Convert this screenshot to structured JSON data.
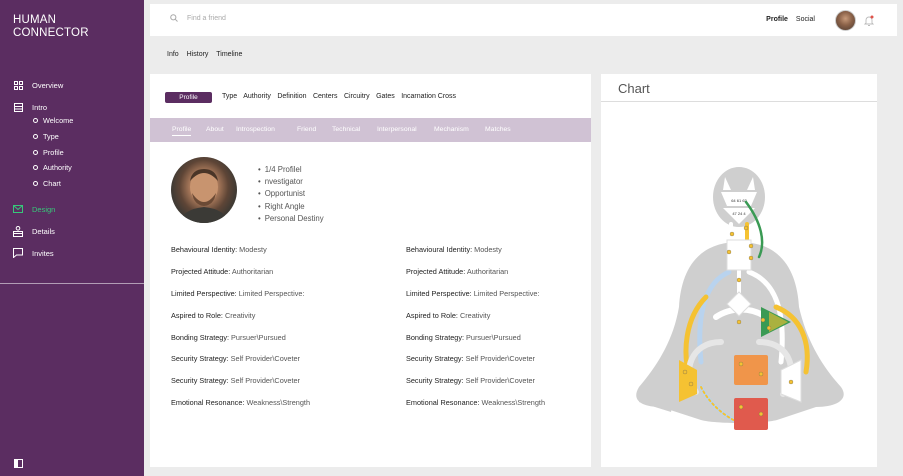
{
  "sidebar": {
    "logo_line1": "HUMAN",
    "logo_line2": "CONNECTOR",
    "items": [
      {
        "label": "Overview",
        "icon": "grid-icon"
      },
      {
        "label": "Intro",
        "icon": "layers-icon"
      },
      {
        "label": "Design",
        "icon": "mail-icon",
        "color": "#37c87a"
      },
      {
        "label": "Details",
        "icon": "person-desk-icon"
      },
      {
        "label": "Invites",
        "icon": "chat-icon"
      }
    ],
    "sub_items": [
      "Welcome",
      "Type",
      "Profile",
      "Authority",
      "Chart"
    ]
  },
  "topbar": {
    "search_placeholder": "Find a friend",
    "profile_link": "Profile",
    "social_link": "Social"
  },
  "subnav": [
    "Info",
    "History",
    "Timeline"
  ],
  "profile_tabs": {
    "pill": "Profile",
    "items": [
      "Type",
      "Authority",
      "Definition",
      "Centers",
      "Circuitry",
      "Gates",
      "Incarnation Cross"
    ]
  },
  "inner_tabs": [
    "Profile",
    "About",
    "Introspection",
    "Friend",
    "Technical",
    "Interpersonal",
    "Mechanism",
    "Matches"
  ],
  "traits": [
    "1/4 Profilel",
    "nvestigator",
    "Opportunist",
    "Right Angle",
    "Personal Destiny"
  ],
  "attributes_left": [
    {
      "label": "Behavioural Identity:",
      "value": "Modesty"
    },
    {
      "label": "Projected Attitude:",
      "value": "Authoritarian"
    },
    {
      "label": "Limited Perspective:",
      "value": "Limited Perspective:"
    },
    {
      "label": "Aspired to Role:",
      "value": "Creativity"
    },
    {
      "label": "Bonding Strategy:",
      "value": "Pursuer\\Pursued"
    },
    {
      "label": "Security Strategy:",
      "value": "Self Provider\\Coveter"
    },
    {
      "label": "Security Strategy:",
      "value": "Self Provider\\Coveter"
    },
    {
      "label": "Emotional Resonance:",
      "value": "Weakness\\Strength"
    }
  ],
  "attributes_right": [
    {
      "label": "Behavioural Identity:",
      "value": "Modesty"
    },
    {
      "label": "Projected Attitude:",
      "value": "Authoritarian"
    },
    {
      "label": "Limited Perspective:",
      "value": "Limited Perspective:"
    },
    {
      "label": "Aspired to Role:",
      "value": "Creativity"
    },
    {
      "label": "Bonding Strategy:",
      "value": "Pursuer\\Pursued"
    },
    {
      "label": "Security Strategy:",
      "value": "Self Provider\\Coveter"
    },
    {
      "label": "Security Strategy:",
      "value": "Self Provider\\Coveter"
    },
    {
      "label": "Emotional Resonance:",
      "value": "Weakness\\Strength"
    }
  ],
  "chart_panel": {
    "title": "Chart",
    "head_gates": "64 61 63",
    "ajna_gates": "47 24 4"
  },
  "colors": {
    "brand": "#5b2d61",
    "tab_bar": "#d0c2d4",
    "design_active": "#37c87a",
    "center_yellow": "#f5c232",
    "center_orange": "#f0954a",
    "center_red": "#e05a4d",
    "center_green": "#3a9a54"
  }
}
